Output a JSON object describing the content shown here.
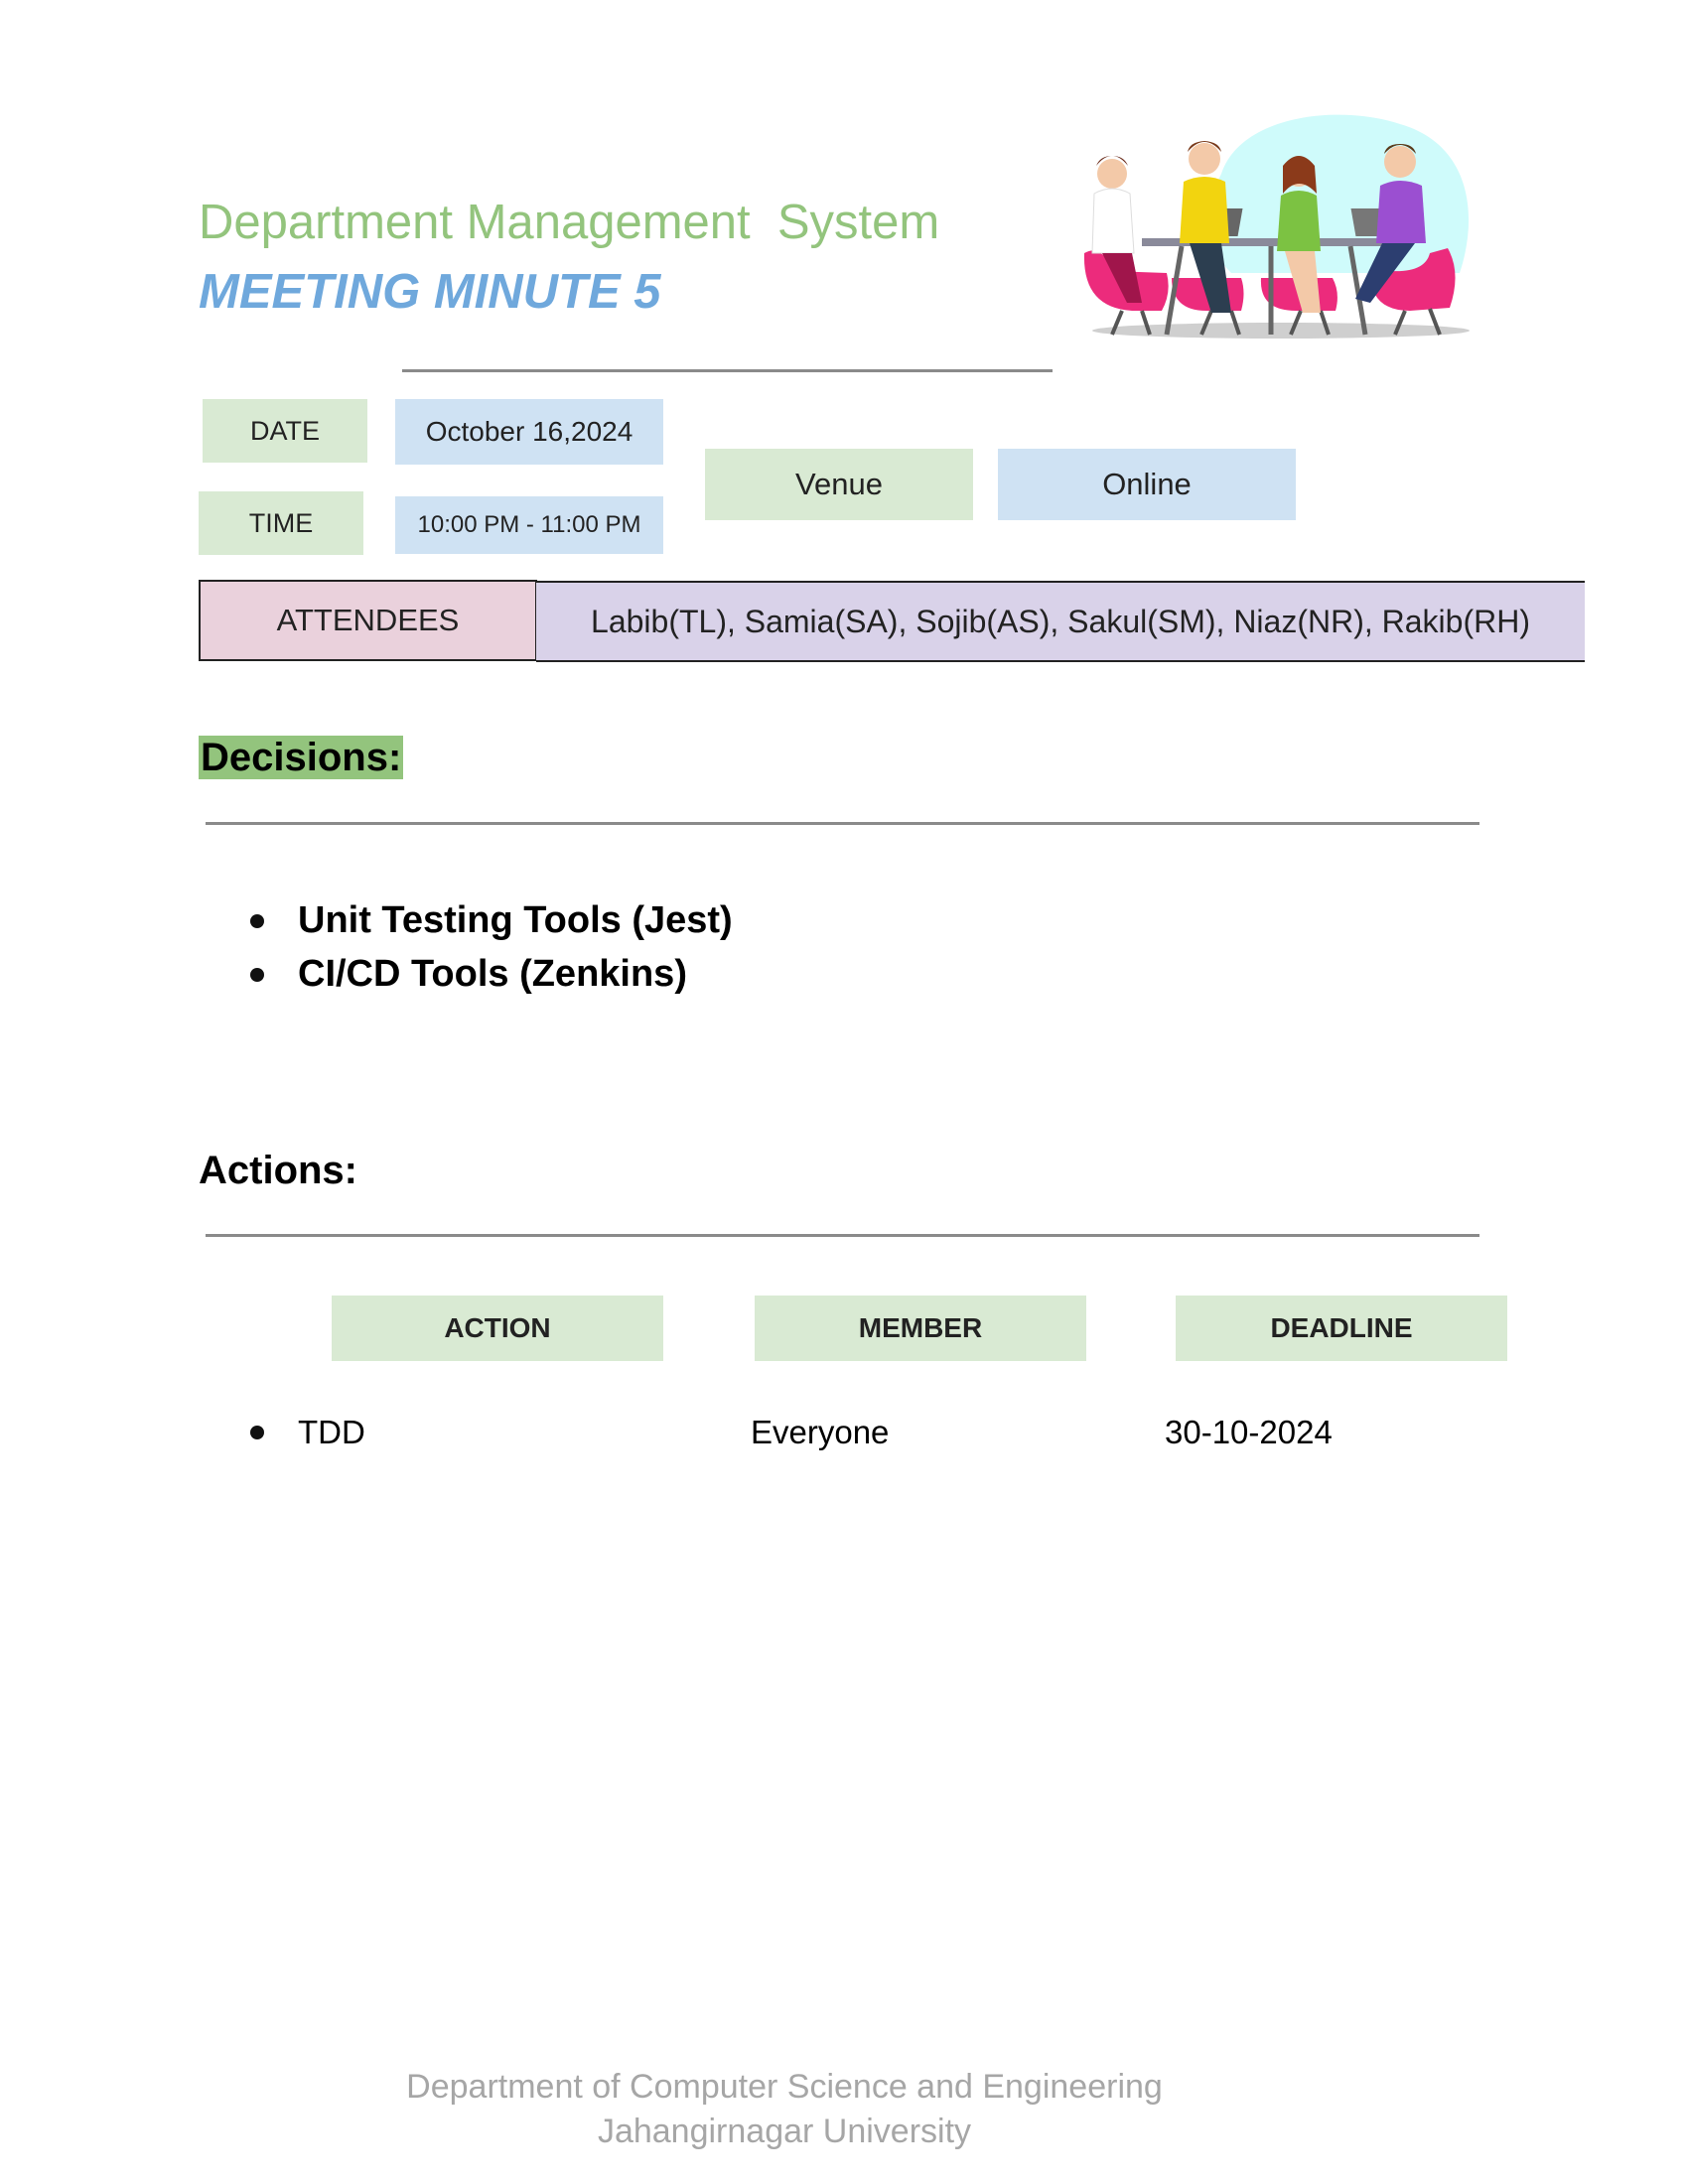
{
  "header": {
    "title": "Department Management  System",
    "subtitle": "MEETING MINUTE 5",
    "illustration": "team-meeting-illustration"
  },
  "info": {
    "date_label": "DATE",
    "date_value": "October 16,2024",
    "time_label": "TIME",
    "time_value": "10:00 PM - 11:00 PM",
    "venue_label": "Venue",
    "venue_value": "Online",
    "attendees_label": "ATTENDEES",
    "attendees_value": "Labib(TL), Samia(SA), Sojib(AS), Sakul(SM), Niaz(NR), Rakib(RH)"
  },
  "decisions": {
    "heading": "Decisions:",
    "items": [
      "Unit Testing Tools (Jest)",
      "CI/CD Tools (Zenkins)"
    ]
  },
  "actions": {
    "heading": "Actions:",
    "columns": [
      "ACTION",
      "MEMBER",
      "DEADLINE"
    ],
    "rows": [
      {
        "action": "TDD",
        "member": "Everyone",
        "deadline": "30-10-2024"
      }
    ]
  },
  "footer": {
    "line1": "Department of Computer Science and Engineering",
    "line2": "Jahangirnagar University"
  },
  "colors": {
    "title_green": "#93c47d",
    "subtitle_blue": "#6fa8dc",
    "label_green": "#d9ead3",
    "value_blue": "#cfe2f3",
    "attendees_pink": "#ead1dc",
    "attendees_lavender": "#d9d2e9"
  }
}
